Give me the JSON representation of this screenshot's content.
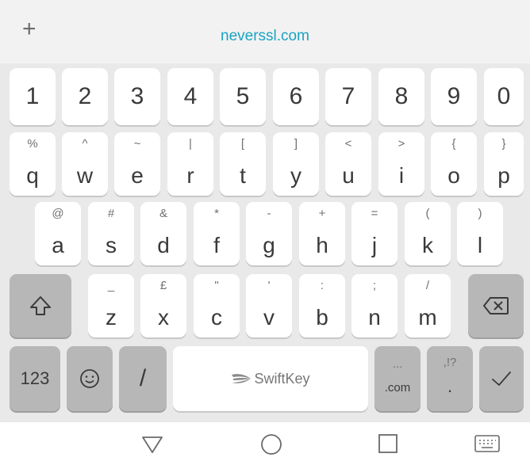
{
  "url_bar": {
    "new_tab_label": "+",
    "url": "neverssl.com"
  },
  "keyboard": {
    "number_row": [
      "1",
      "2",
      "3",
      "4",
      "5",
      "6",
      "7",
      "8",
      "9",
      "0"
    ],
    "row1": [
      {
        "main": "q",
        "sec": "%"
      },
      {
        "main": "w",
        "sec": "^"
      },
      {
        "main": "e",
        "sec": "~"
      },
      {
        "main": "r",
        "sec": "|"
      },
      {
        "main": "t",
        "sec": "["
      },
      {
        "main": "y",
        "sec": "]"
      },
      {
        "main": "u",
        "sec": "<"
      },
      {
        "main": "i",
        "sec": ">"
      },
      {
        "main": "o",
        "sec": "{"
      },
      {
        "main": "p",
        "sec": "}"
      }
    ],
    "row2": [
      {
        "main": "a",
        "sec": "@"
      },
      {
        "main": "s",
        "sec": "#"
      },
      {
        "main": "d",
        "sec": "&"
      },
      {
        "main": "f",
        "sec": "*"
      },
      {
        "main": "g",
        "sec": "-"
      },
      {
        "main": "h",
        "sec": "+"
      },
      {
        "main": "j",
        "sec": "="
      },
      {
        "main": "k",
        "sec": "("
      },
      {
        "main": "l",
        "sec": ")"
      }
    ],
    "row3": [
      {
        "main": "z",
        "sec": "_"
      },
      {
        "main": "x",
        "sec": "£"
      },
      {
        "main": "c",
        "sec": "\""
      },
      {
        "main": "v",
        "sec": "'"
      },
      {
        "main": "b",
        "sec": ":"
      },
      {
        "main": "n",
        "sec": ";"
      },
      {
        "main": "m",
        "sec": "/"
      }
    ],
    "bottom": {
      "numbers_label": "123",
      "slash_label": "/",
      "space_brand": "SwiftKey",
      "dotcom_label": ".com",
      "dotcom_sec": "...",
      "period_label": ".",
      "period_sec": ",!?"
    },
    "icons": {
      "shift": "shift-arrow-icon",
      "backspace": "backspace-icon",
      "emoji": "emoji-icon",
      "enter": "checkmark-icon"
    }
  },
  "navigation": {
    "icons": [
      "back-triangle-icon",
      "home-circle-icon",
      "recents-square-icon",
      "keyboard-icon"
    ]
  },
  "colors": {
    "url": "#1aa3c2",
    "keyboard_bg": "#e9e9e9",
    "key_light": "#ffffff",
    "key_dark": "#b7b7b7",
    "key_text": "#3a3a3a"
  }
}
